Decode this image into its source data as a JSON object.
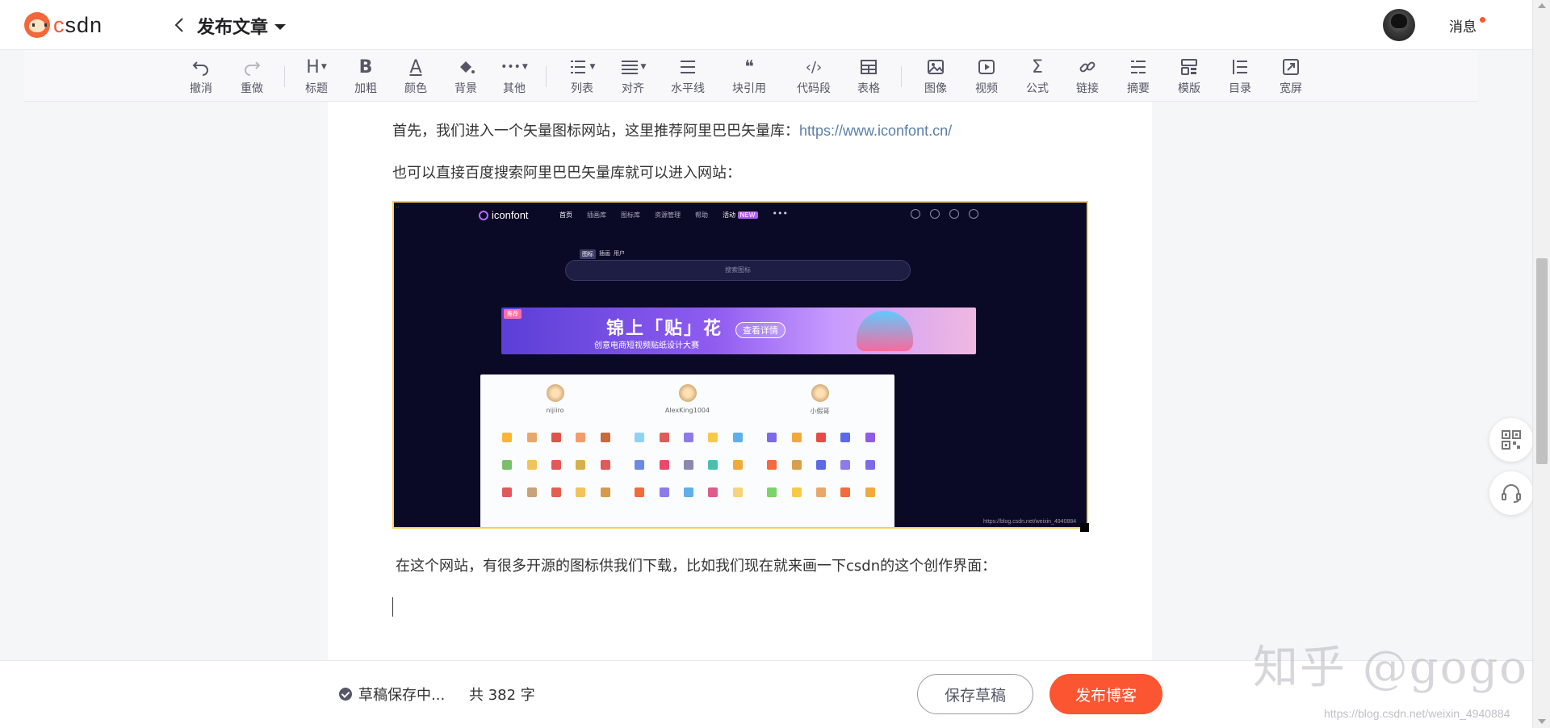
{
  "header": {
    "logo_text": "CSDN",
    "title": "发布文章",
    "messages_label": "消息"
  },
  "toolbar": {
    "items": [
      {
        "label": "撤消",
        "icon": "undo-icon"
      },
      {
        "label": "重做",
        "icon": "redo-icon"
      },
      {
        "label": "标题",
        "icon": "heading-icon",
        "glyph": "H"
      },
      {
        "label": "加粗",
        "icon": "bold-icon",
        "glyph": "B"
      },
      {
        "label": "颜色",
        "icon": "font-color-icon",
        "glyph": "A"
      },
      {
        "label": "背景",
        "icon": "background-color-icon"
      },
      {
        "label": "其他",
        "icon": "more-icon",
        "glyph": "•••"
      },
      {
        "label": "列表",
        "icon": "list-icon"
      },
      {
        "label": "对齐",
        "icon": "align-icon"
      },
      {
        "label": "水平线",
        "icon": "horizontal-rule-icon"
      },
      {
        "label": "块引用",
        "icon": "blockquote-icon",
        "glyph": "❝"
      },
      {
        "label": "代码段",
        "icon": "code-block-icon",
        "glyph": "‹/›"
      },
      {
        "label": "表格",
        "icon": "table-icon"
      },
      {
        "label": "图像",
        "icon": "image-icon"
      },
      {
        "label": "视频",
        "icon": "video-icon"
      },
      {
        "label": "公式",
        "icon": "formula-icon",
        "glyph": "Σ"
      },
      {
        "label": "链接",
        "icon": "link-icon"
      },
      {
        "label": "摘要",
        "icon": "summary-icon"
      },
      {
        "label": "模版",
        "icon": "template-icon"
      },
      {
        "label": "目录",
        "icon": "toc-icon"
      },
      {
        "label": "宽屏",
        "icon": "widescreen-icon"
      }
    ]
  },
  "editor": {
    "paragraph1_text": "首先，我们进入一个矢量图标网站，这里推荐阿里巴巴矢量库：",
    "paragraph1_link": "https://www.iconfont.cn/",
    "paragraph2": "也可以直接百度搜索阿里巴巴矢量库就可以进入网站：",
    "paragraph3": "在这个网站，有很多开源的图标供我们下载，比如我们现在就来画一下csdn的这个创作界面：",
    "embedded": {
      "logo": "iconfont",
      "nav": [
        "首页",
        "插画库",
        "图标库",
        "资源管理",
        "帮助",
        "活动"
      ],
      "nav_badge": "NEW",
      "tabs": [
        "图标",
        "插画",
        "用户"
      ],
      "search_placeholder": "搜索图标",
      "banner_tag": "推荐",
      "banner_title": "锦上「贴」花",
      "banner_sub": "创意电商短视频贴纸设计大赛",
      "banner_button": "查看详情",
      "cards": [
        "nijiiro",
        "AlexKing1004",
        "小假哥"
      ],
      "watermark": "https://blog.csdn.net/weixin_4940884"
    }
  },
  "bottom": {
    "draft_status": "草稿保存中...",
    "word_count": "共 382 字",
    "save_draft": "保存草稿",
    "publish": "发布博客"
  },
  "watermarks": {
    "zhihu": "知乎 @gogo",
    "csdn": "https://blog.csdn.net/weixin_4940884"
  },
  "colors": {
    "accent": "#fc5531",
    "link": "#5a7fa6",
    "image_border": "#f6d24a"
  }
}
